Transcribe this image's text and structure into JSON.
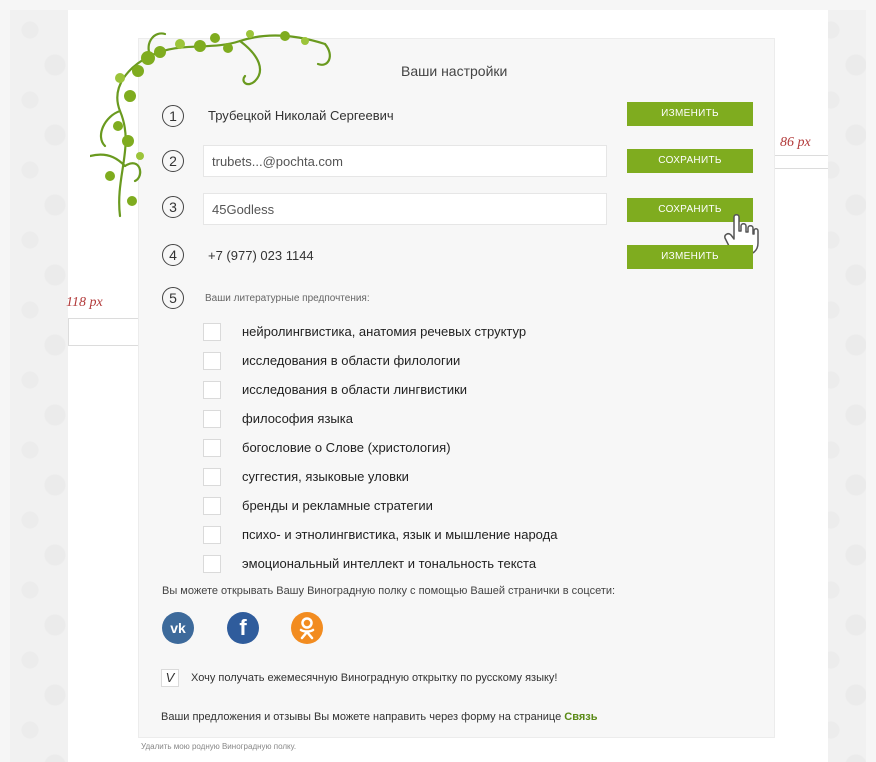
{
  "page": {
    "title": "Ваши настройки"
  },
  "fields": [
    {
      "number": "1",
      "value": "Трубецкой Николай Сергеевич",
      "button": "ИЗМЕНИТЬ"
    },
    {
      "number": "2",
      "value": "trubets...@pochta.com",
      "button": "СОХРАНИТЬ"
    },
    {
      "number": "3",
      "value": "45Godless",
      "button": "СОХРАНИТЬ"
    },
    {
      "number": "4",
      "value": "+7 (977) 023 1144",
      "button": "ИЗМЕНИТЬ"
    }
  ],
  "preferences": {
    "number": "5",
    "heading": "Ваши литературные предпочтения:",
    "items": [
      "нейролингвистика, анатомия речевых структур",
      "исследования в области филологии",
      "исследования в области лингвистики",
      "философия языка",
      "богословие о Слове (христология)",
      "суггестия, языковые уловки",
      "бренды и рекламные стратегии",
      "психо- и этнолингвистика, язык и мышление народа",
      "эмоциональный интеллект и тональность текста"
    ]
  },
  "social": {
    "note": "Вы можете открывать Вашу Виноградную полку с помощью Вашей странички в соцсети:",
    "networks": [
      {
        "name": "vk-icon",
        "glyph": "vk"
      },
      {
        "name": "facebook-icon",
        "glyph": "f"
      },
      {
        "name": "odnoklassniki-icon",
        "glyph": "ok"
      }
    ]
  },
  "subscription": {
    "checked": true,
    "mark": "V",
    "label": "Хочу получать ежемесячную Виноградную открытку по русскому языку!"
  },
  "feedback": {
    "text": "Ваши предложения и отзывы Вы можете направить через форму на странице ",
    "link": "Связь"
  },
  "delete_link": "Удалить мою родную Виноградную полку.",
  "annotations": {
    "left_margin": "118 px",
    "right_margin": "86 px"
  },
  "colors": {
    "accent": "#7fac1f",
    "vine": "#6a9a1f",
    "annotation": "#b23a3a"
  }
}
